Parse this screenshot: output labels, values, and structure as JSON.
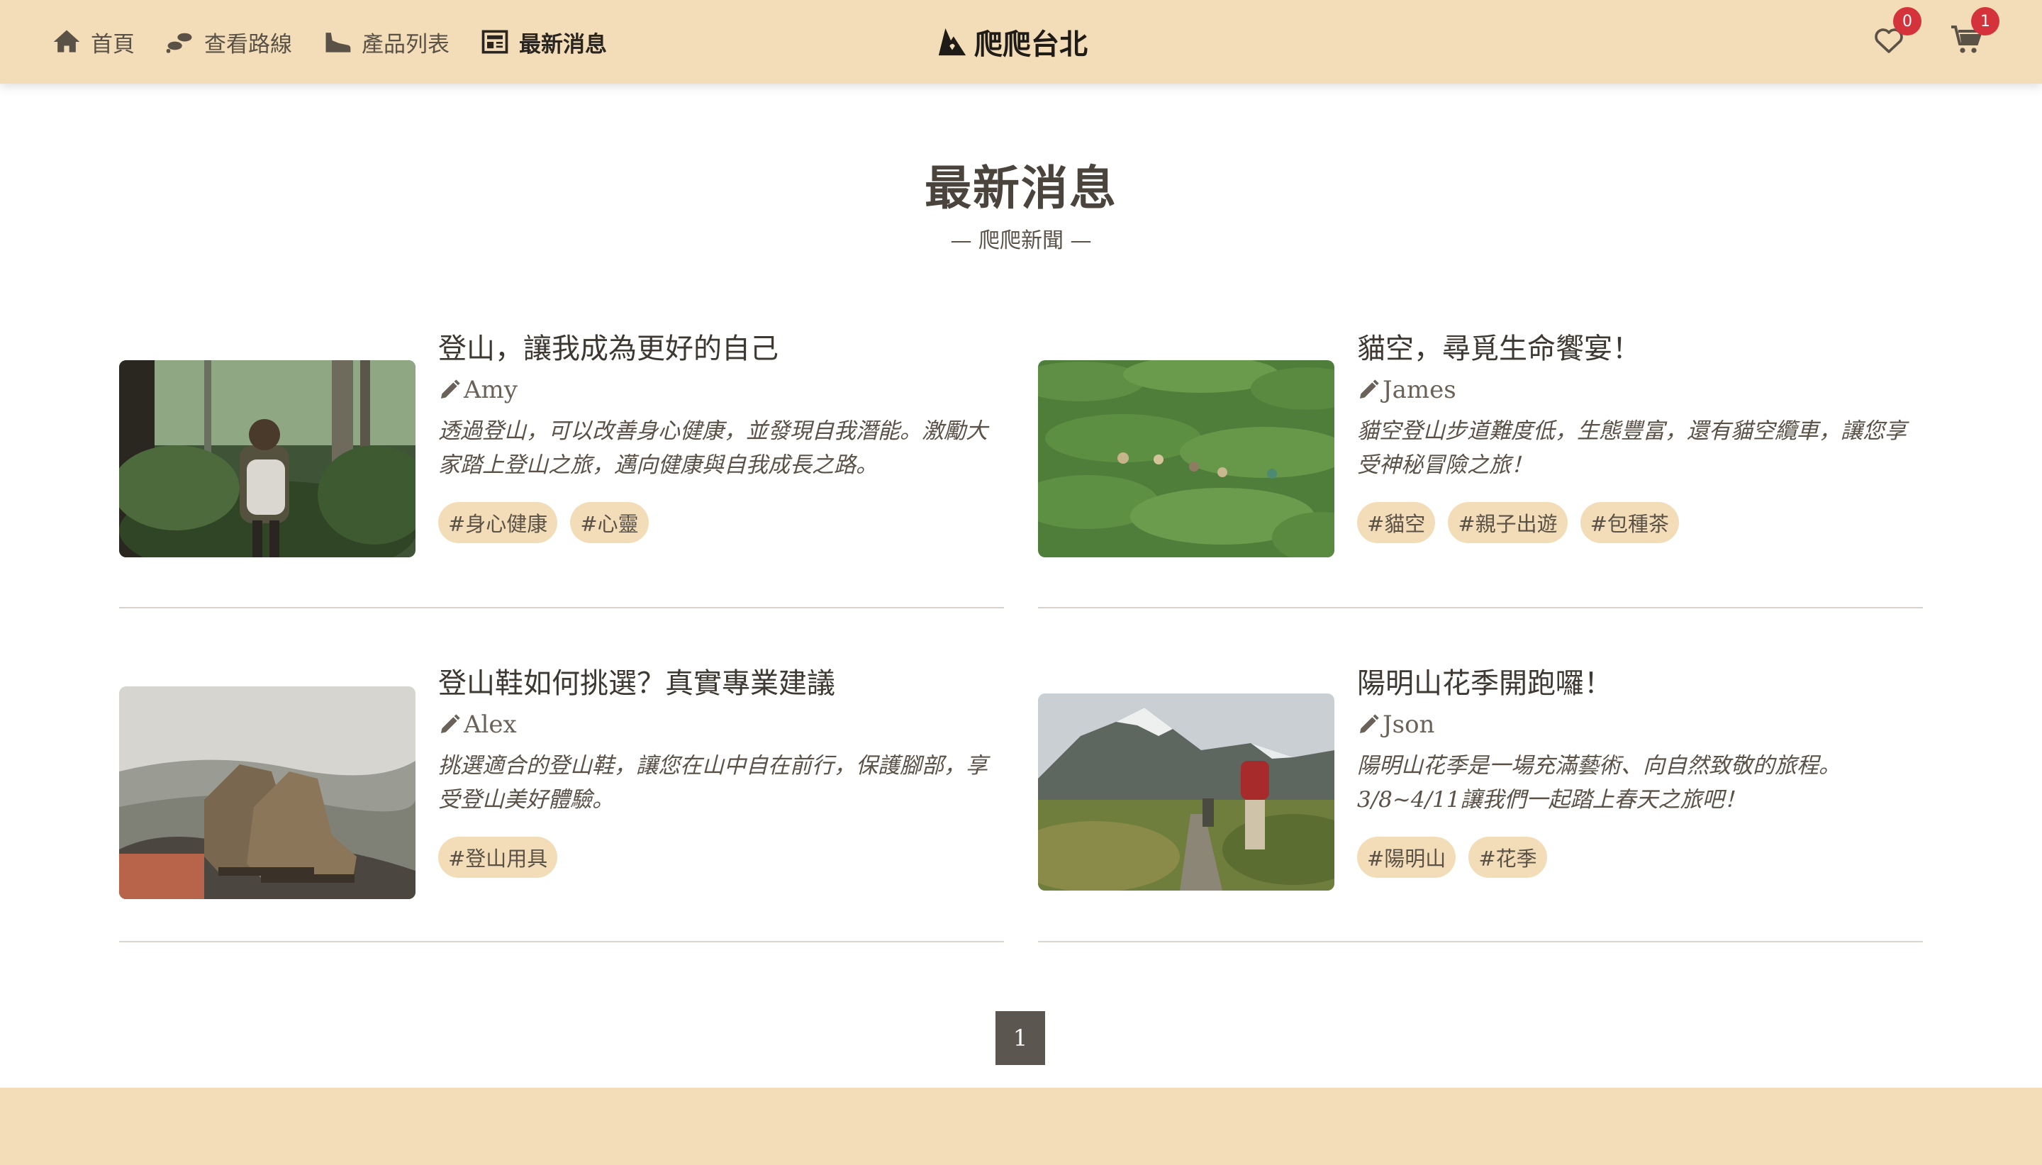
{
  "nav": {
    "items": [
      {
        "label": "首頁",
        "icon": "home-icon"
      },
      {
        "label": "查看路線",
        "icon": "footprints-icon"
      },
      {
        "label": "產品列表",
        "icon": "shoe-icon"
      },
      {
        "label": "最新消息",
        "icon": "newspaper-icon",
        "active": true
      }
    ],
    "brand": "爬爬台北",
    "favorites_count": "0",
    "cart_count": "1"
  },
  "page": {
    "title": "最新消息",
    "subtitle": "— 爬爬新聞 —"
  },
  "articles": [
    {
      "title": "登山，讓我成為更好的自己",
      "author": "Amy",
      "description": "透過登山，可以改善身心健康，並發現自我潛能。激勵大家踏上登山之旅，邁向健康與自我成長之路。",
      "tags": [
        "#身心健康",
        "#心靈"
      ]
    },
    {
      "title": "貓空，尋覓生命饗宴！",
      "author": "James",
      "description": "貓空登山步道難度低，生態豐富，還有貓空纜車，讓您享受神秘冒險之旅！",
      "tags": [
        "#貓空",
        "#親子出遊",
        "#包種茶"
      ]
    },
    {
      "title": "登山鞋如何挑選？真實專業建議",
      "author": "Alex",
      "description": "挑選適合的登山鞋，讓您在山中自在前行，保護腳部，享受登山美好體驗。",
      "tags": [
        "#登山用具"
      ]
    },
    {
      "title": "陽明山花季開跑囉！",
      "author": "Json",
      "description": "陽明山花季是一場充滿藝術、向自然致敬的旅程。3/8~4/11讓我們一起踏上春天之旅吧！",
      "tags": [
        "#陽明山",
        "#花季"
      ]
    }
  ],
  "pagination": {
    "current_page": "1"
  },
  "colors": {
    "nav_bg": "#f3ddb8",
    "tag_bg": "#f3ddb8",
    "badge": "#d4333c",
    "pager_bg": "#5b564f",
    "text": "#4a443d"
  }
}
